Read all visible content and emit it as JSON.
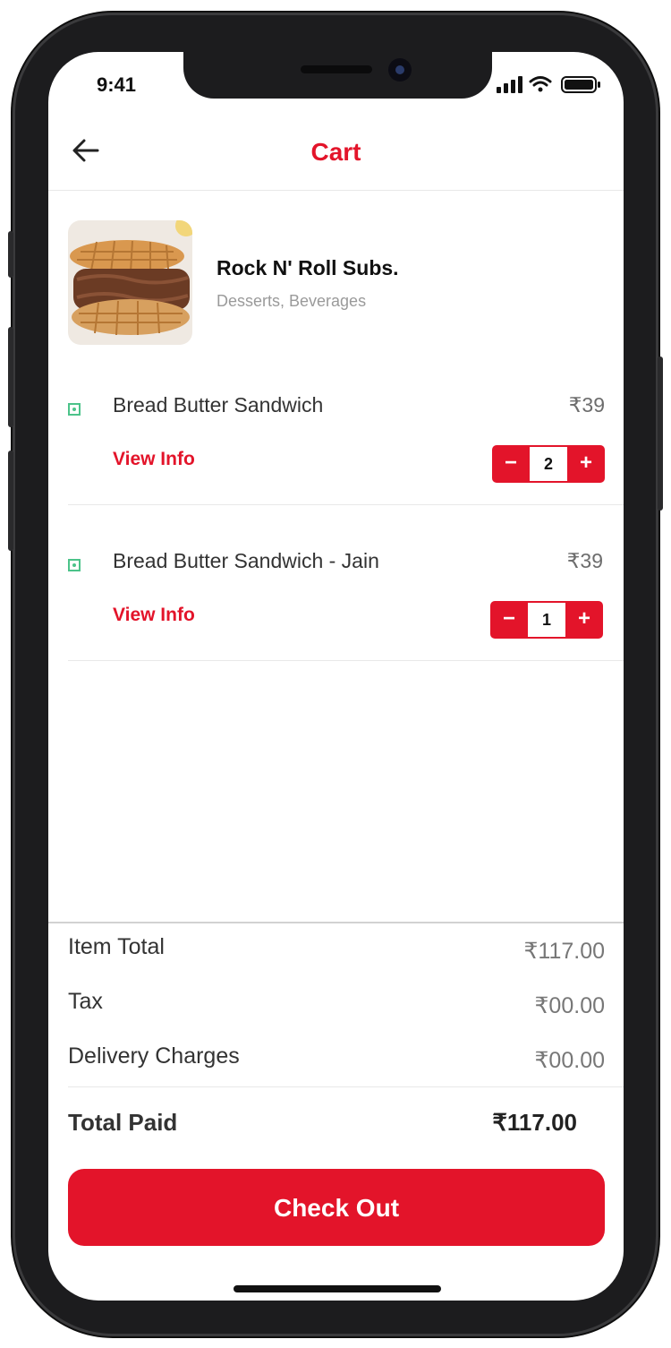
{
  "status_bar": {
    "time": "9:41"
  },
  "header": {
    "title": "Cart"
  },
  "store": {
    "name": "Rock N' Roll Subs.",
    "categories": "Desserts, Beverages"
  },
  "items": [
    {
      "name": "Bread Butter Sandwich",
      "price": "₹39",
      "link": "View Info",
      "quantity": "2"
    },
    {
      "name": "Bread Butter Sandwich - Jain",
      "price": "₹39",
      "link": "View Info",
      "quantity": "1"
    }
  ],
  "summary": {
    "item_total_label": "Item Total",
    "item_total_value": "₹117.00",
    "tax_label": "Tax",
    "tax_value": "₹00.00",
    "delivery_label": "Delivery Charges",
    "delivery_value": "₹00.00",
    "total_label": "Total Paid",
    "total_value": "₹117.00"
  },
  "checkout_label": "Check Out",
  "colors": {
    "accent": "#e3142a",
    "veg": "#4cc38a"
  },
  "icons": {
    "back": "arrow-left-icon",
    "veg": "veg-indicator-icon",
    "signal": "cellular-signal-icon",
    "wifi": "wifi-icon",
    "battery": "battery-icon"
  }
}
